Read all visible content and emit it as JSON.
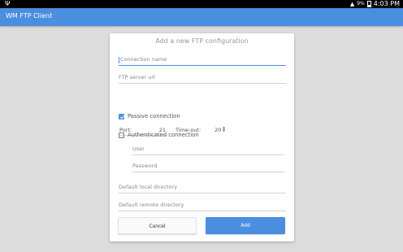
{
  "status_bar": {
    "usb_icon": "usb-icon",
    "wifi_icon": "wifi-icon",
    "battery_text": "9%",
    "time": "4:03 PM"
  },
  "app_bar": {
    "title": "WM FTP Client",
    "color": "#4a8ee0"
  },
  "dialog": {
    "title": "Add a new FTP configuration",
    "connection_name": {
      "placeholder": "Connection name",
      "value": ""
    },
    "server_url": {
      "placeholder": "FTP server url",
      "value": ""
    },
    "port": {
      "label": "Port:",
      "value": "21"
    },
    "timeout": {
      "label": "Time-out:",
      "value": "20"
    },
    "passive": {
      "label": "Passive connection",
      "checked": true
    },
    "authenticated": {
      "label": "Authenticated connection",
      "checked": false
    },
    "user": {
      "placeholder": "User",
      "value": ""
    },
    "password": {
      "placeholder": "Password",
      "value": ""
    },
    "local_dir": {
      "placeholder": "Default local directory",
      "value": ""
    },
    "remote_dir": {
      "placeholder": "Default remote directory",
      "value": ""
    },
    "cancel_label": "Cancel",
    "add_label": "Add"
  }
}
